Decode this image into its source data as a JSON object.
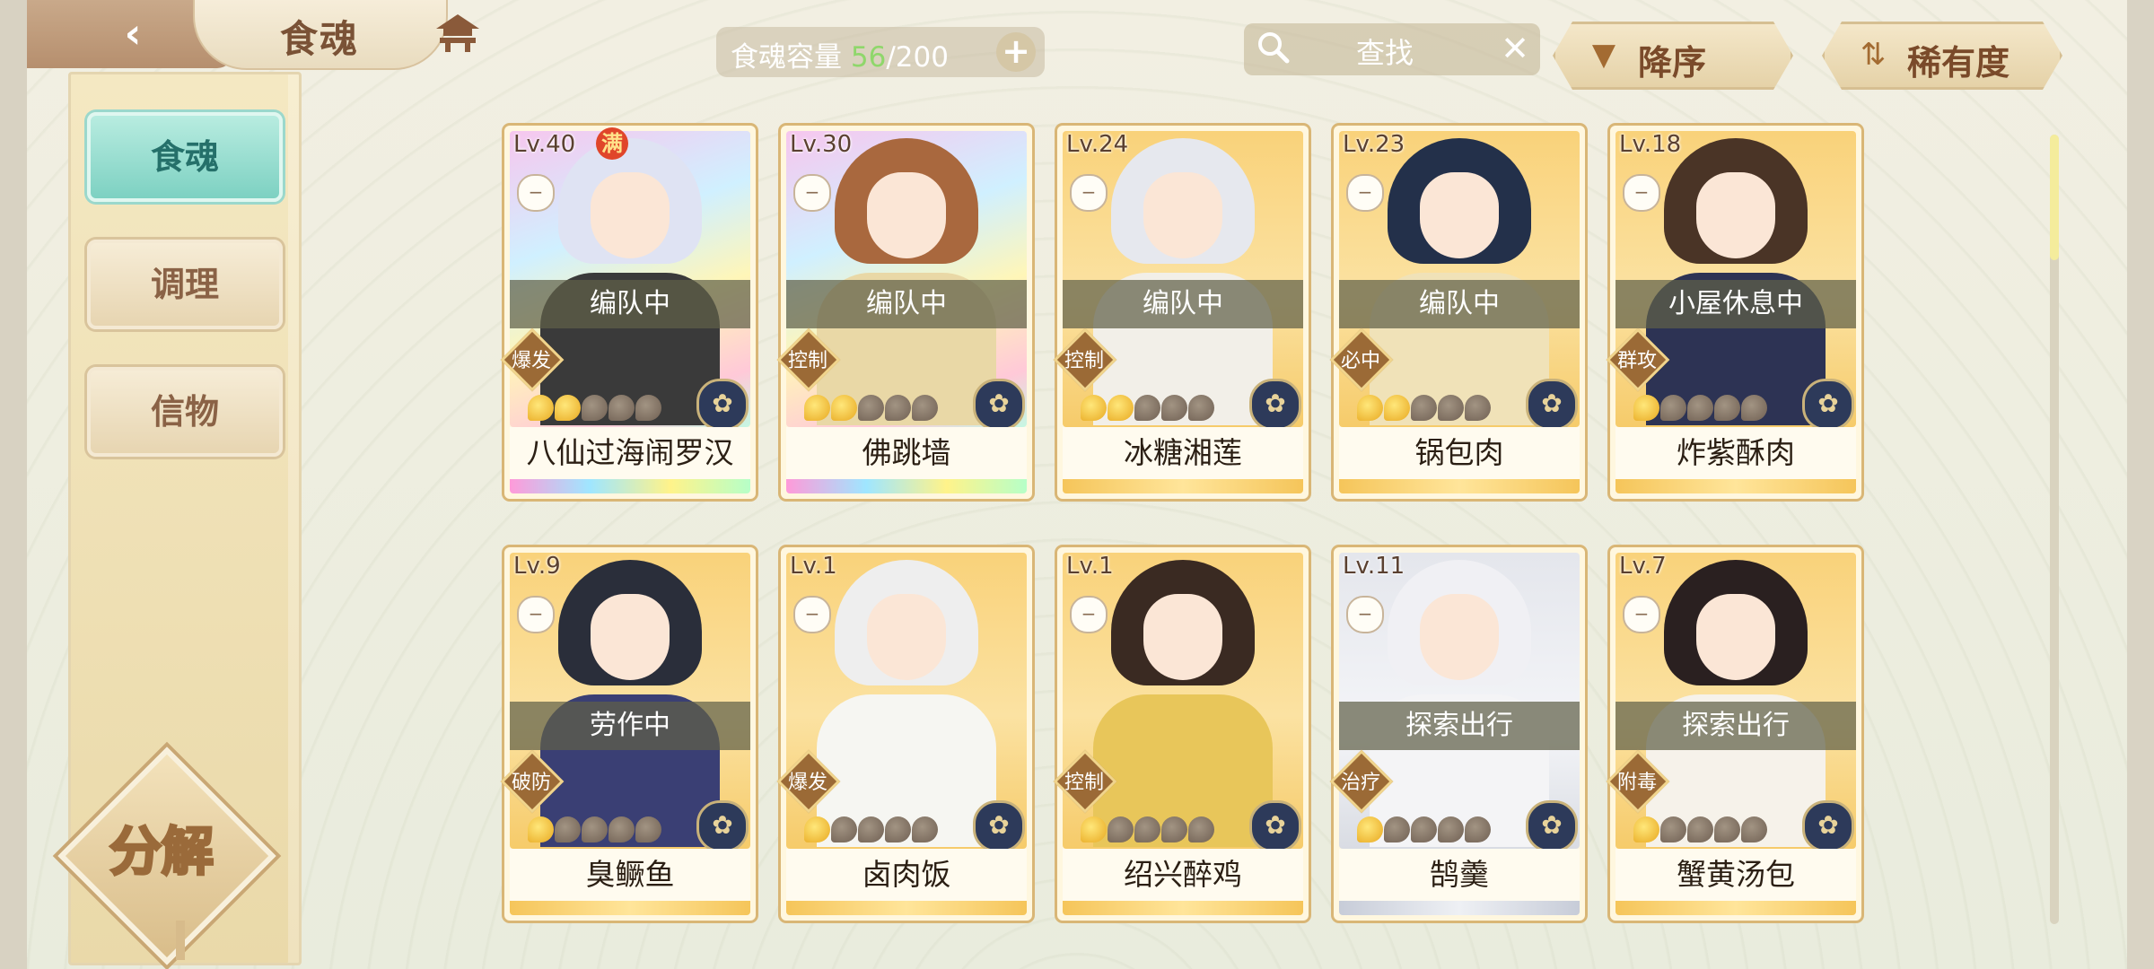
{
  "header": {
    "back_icon": "back-arrow-icon",
    "title": "食魂",
    "home_icon": "house-icon",
    "capacity_label": "食魂容量",
    "capacity_current": "56",
    "capacity_total": "/200",
    "capacity_add_icon": "plus-icon",
    "search_placeholder": "查找",
    "sort_order_label": "降序",
    "sort_key_label": "稀有度"
  },
  "sidebar": {
    "items": [
      {
        "label": "食魂",
        "active": true
      },
      {
        "label": "调理",
        "active": false
      },
      {
        "label": "信物",
        "active": false
      }
    ],
    "decompose_label": "分解"
  },
  "cards": [
    {
      "level": "Lv.40",
      "full": "满",
      "status": "编队中",
      "role": "爆发",
      "stars": 2,
      "name": "八仙过海闹罗汉",
      "frame": "rainbow",
      "hair": "#dfe3f3",
      "body": "#3a3a3a"
    },
    {
      "level": "Lv.30",
      "full": "",
      "status": "编队中",
      "role": "控制",
      "stars": 2,
      "name": "佛跳墙",
      "frame": "rainbow",
      "hair": "#a9683e",
      "body": "#e9d8a6"
    },
    {
      "level": "Lv.24",
      "full": "",
      "status": "编队中",
      "role": "控制",
      "stars": 2,
      "name": "冰糖湘莲",
      "frame": "gold",
      "hair": "#e6e8ee",
      "body": "#f2efe8"
    },
    {
      "level": "Lv.23",
      "full": "",
      "status": "编队中",
      "role": "必中",
      "stars": 2,
      "name": "锅包肉",
      "frame": "gold",
      "hair": "#23304a",
      "body": "#f0e2b8"
    },
    {
      "level": "Lv.18",
      "full": "",
      "status": "小屋休息中",
      "role": "群攻",
      "stars": 1,
      "name": "炸紫酥肉",
      "frame": "gold",
      "hair": "#4a3426",
      "body": "#2d3354"
    },
    {
      "level": "Lv.9",
      "full": "",
      "status": "劳作中",
      "role": "破防",
      "stars": 1,
      "name": "臭鳜鱼",
      "frame": "gold",
      "hair": "#2a2e3a",
      "body": "#3a3f74"
    },
    {
      "level": "Lv.1",
      "full": "",
      "status": "",
      "role": "爆发",
      "stars": 1,
      "name": "卤肉饭",
      "frame": "gold",
      "hair": "#eeeeee",
      "body": "#f6f6f2"
    },
    {
      "level": "Lv.1",
      "full": "",
      "status": "",
      "role": "控制",
      "stars": 1,
      "name": "绍兴醉鸡",
      "frame": "gold",
      "hair": "#3a2a22",
      "body": "#e8c65a"
    },
    {
      "level": "Lv.11",
      "full": "",
      "status": "探索出行",
      "role": "治疗",
      "stars": 1,
      "name": "鹄羹",
      "frame": "silver",
      "hair": "#f0f0f4",
      "body": "#f4f4f6"
    },
    {
      "level": "Lv.7",
      "full": "",
      "status": "探索出行",
      "role": "附毒",
      "stars": 1,
      "name": "蟹黄汤包",
      "frame": "gold",
      "hair": "#2a2020",
      "body": "#f6f2ea"
    }
  ],
  "colors": {
    "accent_teal": "#7dd1c2",
    "capacity_current": "#8fd76b",
    "brown_text": "#7a4a2a"
  }
}
